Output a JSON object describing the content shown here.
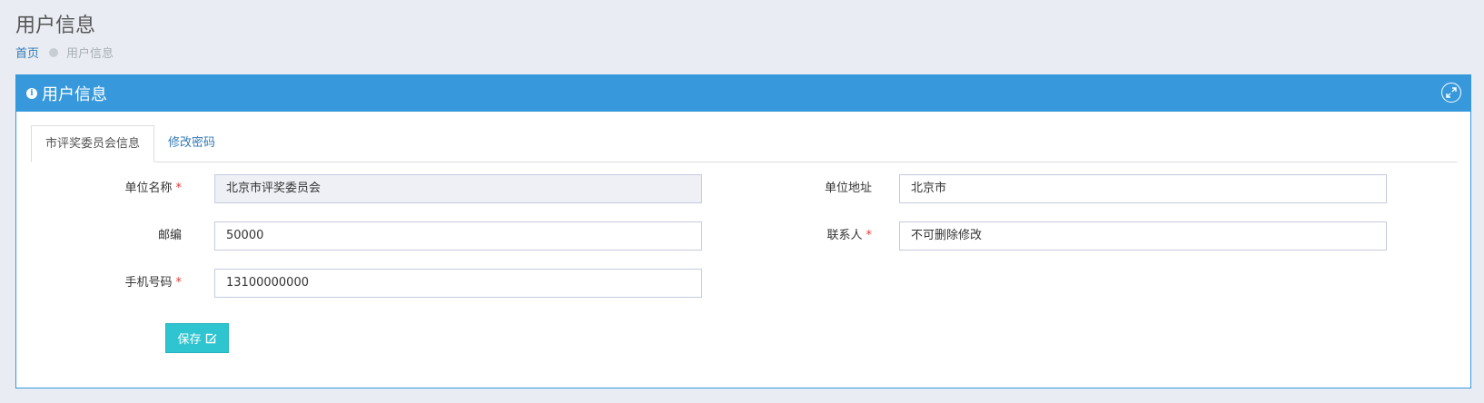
{
  "page": {
    "title": "用户信息"
  },
  "breadcrumb": {
    "home": "首页",
    "current": "用户信息"
  },
  "panel": {
    "title": "用户信息"
  },
  "tabs": [
    {
      "label": "市评奖委员会信息",
      "active": true
    },
    {
      "label": "修改密码",
      "active": false
    }
  ],
  "form": {
    "unit_name": {
      "label": "单位名称",
      "required": "*",
      "value": "北京市评奖委员会"
    },
    "unit_address": {
      "label": "单位地址",
      "value": "北京市"
    },
    "postcode": {
      "label": "邮编",
      "value": "50000"
    },
    "contact": {
      "label": "联系人",
      "required": "*",
      "value": "不可删除修改"
    },
    "phone": {
      "label": "手机号码",
      "required": "*",
      "value": "13100000000"
    }
  },
  "actions": {
    "save_label": "保存"
  },
  "icons": {
    "info": "info-circle-icon",
    "expand": "expand-icon",
    "edit": "edit-icon"
  },
  "colors": {
    "header_blue": "#3799dc",
    "save_teal": "#2ec5d1",
    "link_blue": "#337ab7",
    "required_red": "#e53935"
  }
}
